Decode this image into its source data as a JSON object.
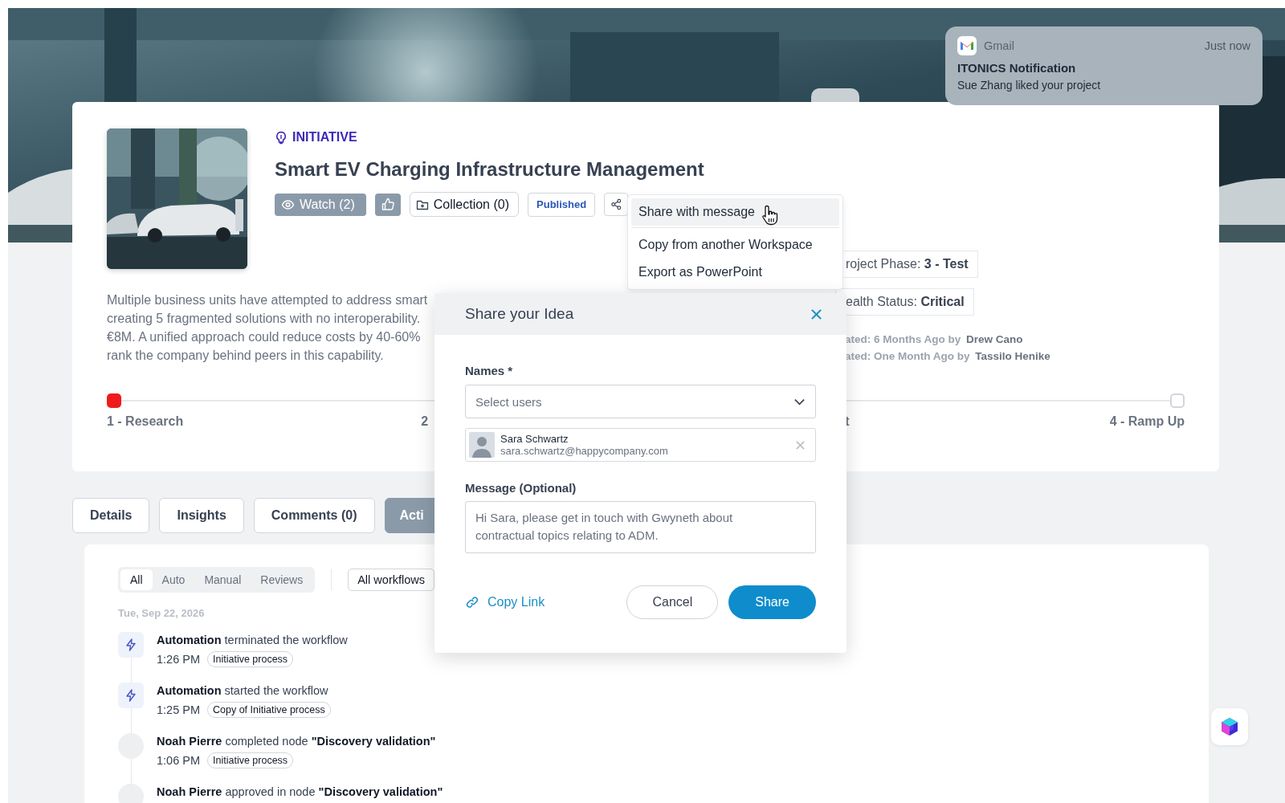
{
  "notification": {
    "app": "Gmail",
    "time": "Just now",
    "title": "ITONICS Notification",
    "body": "Sue Zhang liked your project"
  },
  "initiative": {
    "type_label": "INITIATIVE",
    "title": "Smart EV Charging Infrastructure Management",
    "actions": [
      {
        "kind": "watch",
        "label": "Watch (2)"
      },
      {
        "kind": "like"
      },
      {
        "kind": "collection",
        "label": "Collection (0)"
      },
      {
        "kind": "status",
        "label": "Published"
      },
      {
        "kind": "share"
      }
    ],
    "description_lines": [
      "Multiple business units have attempted to address smart",
      "creating 5 fragmented solutions with no interoperability.",
      "€8M. A unified approach could reduce costs by 40-60%",
      "rank the company behind peers in this capability."
    ],
    "chips": [
      "roject Phase: **3 - Test**",
      "ealth Status: **Critical**"
    ],
    "updates": [
      "ated: 6 Months Ago by **Drew Cano**",
      "ated: One Month Ago by **Tassilo Henike**"
    ],
    "stages": [
      {
        "label": "1 - Research",
        "current": true
      },
      {
        "label": "2"
      },
      {
        "label": "t"
      },
      {
        "label": "4 - Ramp Up",
        "current": false
      }
    ]
  },
  "share_menu": {
    "items": [
      {
        "label": "Share with message",
        "selected": true
      },
      {
        "label": "Copy from another Workspace",
        "selected": false
      },
      {
        "label": "Export as PowerPoint",
        "selected": false
      }
    ]
  },
  "tabs": [
    {
      "label": "Details",
      "selected": false
    },
    {
      "label": "Insights",
      "selected": false
    },
    {
      "label": "Comments (0)",
      "selected": false
    },
    {
      "label": "Acti",
      "selected": true
    }
  ],
  "activity": {
    "filters": [
      {
        "label": "All",
        "selected": true
      },
      {
        "label": "Auto",
        "selected": false
      },
      {
        "label": "Manual",
        "selected": false
      },
      {
        "label": "Reviews",
        "selected": false
      }
    ],
    "workflow_filter": "All workflows",
    "date": "Tue, Sep 22, 2026",
    "events": [
      {
        "kind": "automation",
        "text": "**Automation** terminated the workflow",
        "time": "1:26 PM",
        "tag": "Initiative process"
      },
      {
        "kind": "automation",
        "text": "**Automation** started the workflow",
        "time": "1:25 PM",
        "tag": "Copy of Initiative process"
      },
      {
        "kind": "user",
        "text": "**Noah Pierre** completed node **\"Discovery validation\"**",
        "time": "1:06 PM",
        "tag": "Initiative process"
      },
      {
        "kind": "user",
        "text": "**Noah Pierre** approved in node **\"Discovery validation\"**"
      }
    ]
  },
  "share_dialog": {
    "title": "Share your Idea",
    "names_label": "Names *",
    "select_placeholder": "Select users",
    "recipients": [
      {
        "name": "Sara Schwartz",
        "email": "sara.schwartz@happycompany.com"
      }
    ],
    "message_label": "Message (Optional)",
    "message": "Hi Sara, please get in touch with Gwyneth about contractual topics relating to ADM.",
    "copy_link": "Copy Link",
    "cancel": "Cancel",
    "share": "Share"
  }
}
